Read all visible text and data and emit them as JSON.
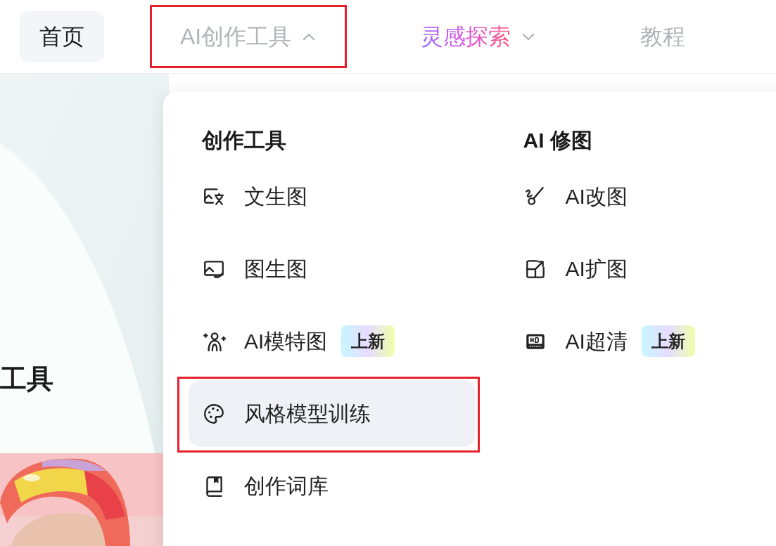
{
  "nav": [
    {
      "label": "首页",
      "selected": true
    },
    {
      "label": "AI创作工具",
      "selected": false,
      "expanded": true,
      "highlighted": true
    },
    {
      "label": "灵感探索",
      "selected": false,
      "expanded": false,
      "kind": "gradient"
    },
    {
      "label": "教程",
      "selected": false
    }
  ],
  "hero": {
    "title": "工具"
  },
  "menu": {
    "columns": [
      {
        "heading": "创作工具",
        "items": [
          {
            "label": "文生图",
            "selected": false,
            "highlighted": false
          },
          {
            "label": "图生图",
            "selected": false,
            "highlighted": false
          },
          {
            "label": "AI模特图",
            "selected": false,
            "highlighted": false,
            "badge": "上新"
          },
          {
            "label": "风格模型训练",
            "selected": true,
            "highlighted": true
          },
          {
            "label": "创作词库",
            "selected": false,
            "highlighted": false
          }
        ]
      },
      {
        "heading": "AI 修图",
        "items": [
          {
            "label": "AI改图",
            "selected": false,
            "highlighted": false
          },
          {
            "label": "AI扩图",
            "selected": false,
            "highlighted": false
          },
          {
            "label": "AI超清",
            "selected": false,
            "highlighted": false,
            "badge": "上新"
          }
        ]
      }
    ]
  }
}
